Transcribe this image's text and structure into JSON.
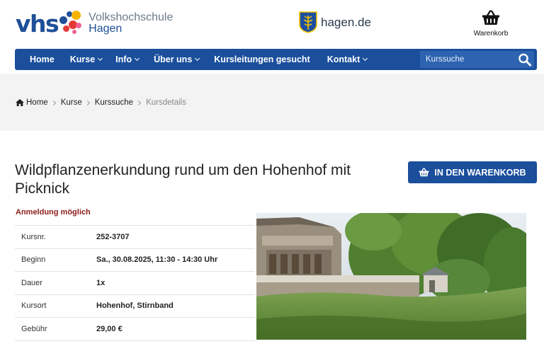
{
  "brand": {
    "logo_mark": "vhs",
    "name_line1": "Volkshochschule",
    "name_line2": "Hagen",
    "colors": {
      "primary": "#1b4f9c",
      "status_red": "#8b1a1a",
      "logo_dots": [
        "#1f4f97",
        "#e53935",
        "#f5b400",
        "#f06292"
      ]
    }
  },
  "partner": {
    "icon": "hagen-crest-icon",
    "label": "hagen.de"
  },
  "cart": {
    "icon": "basket-icon",
    "label": "Warenkorb"
  },
  "nav": {
    "items": [
      {
        "label": "Home",
        "dropdown": false
      },
      {
        "label": "Kurse",
        "dropdown": true
      },
      {
        "label": "Info",
        "dropdown": true
      },
      {
        "label": "Über uns",
        "dropdown": true
      },
      {
        "label": "Kursleitungen gesucht",
        "dropdown": false
      },
      {
        "label": "Kontakt",
        "dropdown": true
      }
    ],
    "search": {
      "placeholder": "Kurssuche",
      "icon": "search-icon"
    }
  },
  "breadcrumb": {
    "icon": "home-icon",
    "items": [
      "Home",
      "Kurse",
      "Kurssuche"
    ],
    "current": "Kursdetails"
  },
  "course": {
    "title": "Wildpflanzenerkundung rund um den Hohenhof mit Picknick",
    "add_to_cart_label": "IN DEN WARENKORB",
    "status": "Anmeldung möglich",
    "details": [
      {
        "label": "Kursnr.",
        "value": "252-3707"
      },
      {
        "label": "Beginn",
        "value": "Sa., 30.08.2025, 11:30 - 14:30 Uhr"
      },
      {
        "label": "Dauer",
        "value": "1x"
      },
      {
        "label": "Kursort",
        "value": "Hohenhof, Stirnband"
      },
      {
        "label": "Gebühr",
        "value": "29,00 €"
      }
    ]
  }
}
